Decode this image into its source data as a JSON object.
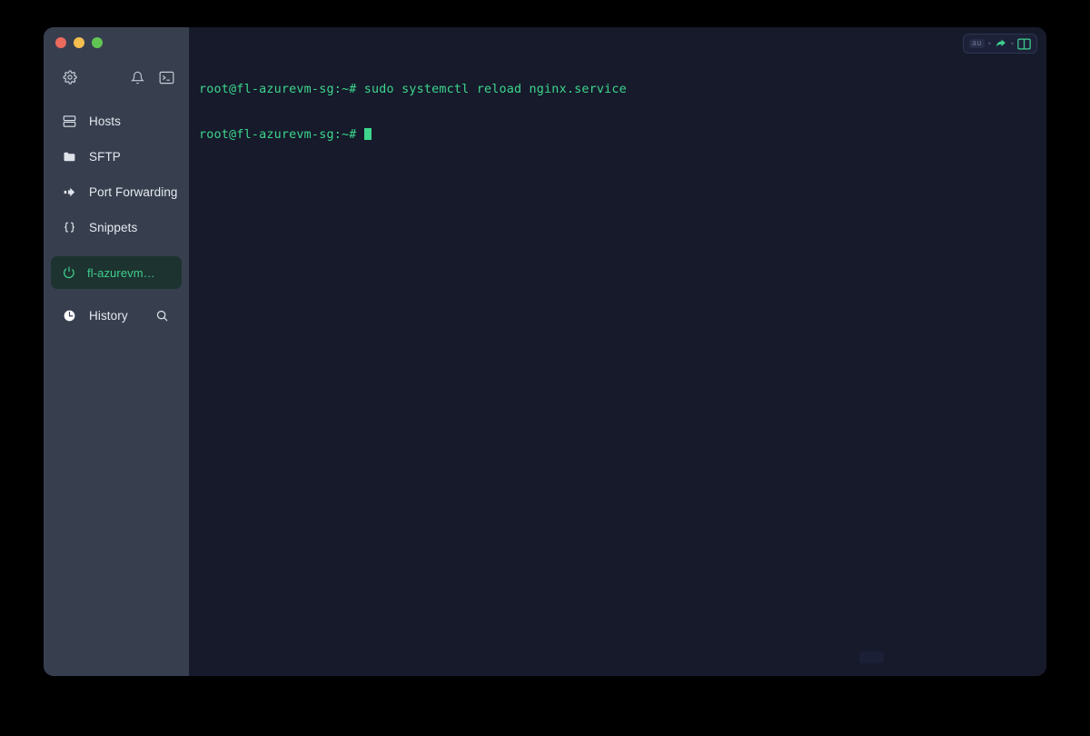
{
  "window": {
    "traffic_lights": [
      {
        "name": "close",
        "color": "#ed6a5e"
      },
      {
        "name": "minimize",
        "color": "#f4bf4f"
      },
      {
        "name": "maximize",
        "color": "#61c554"
      }
    ]
  },
  "sidebar": {
    "background": "#373f4f",
    "toolbar": [
      {
        "icon": "gear-icon",
        "label": "Settings"
      },
      {
        "icon": "bell-icon",
        "label": "Notifications"
      },
      {
        "icon": "terminal-icon",
        "label": "Terminal"
      }
    ],
    "nav_items": [
      {
        "icon": "server-rack-icon",
        "label": "Hosts"
      },
      {
        "icon": "folder-icon",
        "label": "SFTP"
      },
      {
        "icon": "arrow-right-icon",
        "label": "Port Forwarding"
      },
      {
        "icon": "braces-icon",
        "label": "Snippets"
      }
    ],
    "sessions": [
      {
        "icon": "session-active-icon",
        "label": "fl-azurevm…",
        "active": true,
        "color": "#3ecf8e"
      }
    ],
    "history": {
      "icon": "clock-icon",
      "label": "History",
      "search_icon": "search-icon"
    }
  },
  "terminal": {
    "background": "#161a2b",
    "text_color": "#3dd68c",
    "lines": [
      "root@fl-azurevm-sg:~# sudo systemctl reload nginx.service",
      "root@fl-azurevm-sg:~# "
    ],
    "line1": "root@fl-azurevm-sg:~# sudo systemctl reload nginx.service",
    "line2": "root@fl-azurevm-sg:~# ",
    "cursor": "block"
  },
  "pane_controls": {
    "badge_label": "au",
    "separator": "•",
    "share_icon": "share-arrow-icon",
    "split_icon": "split-pane-icon",
    "accent": "#3ecf8e"
  }
}
